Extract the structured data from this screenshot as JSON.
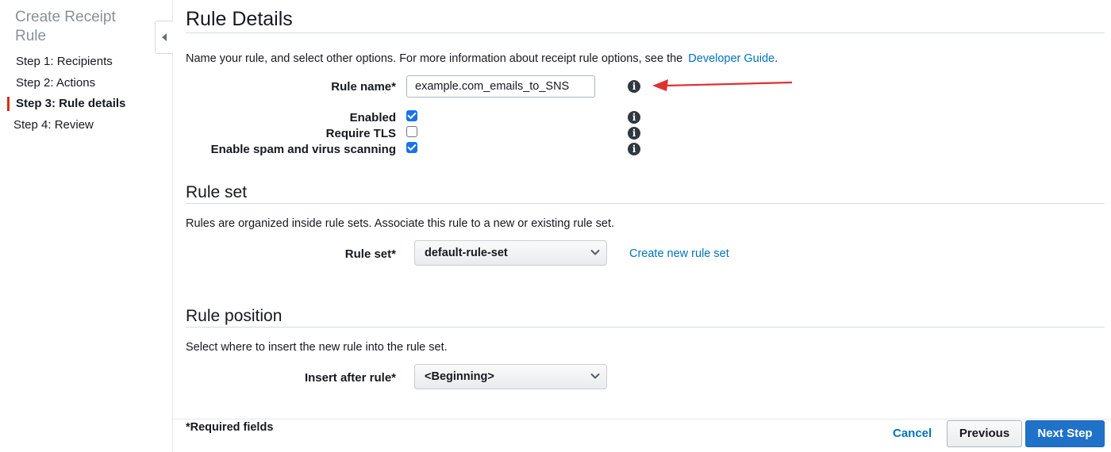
{
  "sidebar": {
    "title": "Create Receipt Rule",
    "steps": [
      {
        "label": "Step 1: Recipients"
      },
      {
        "label": "Step 2: Actions"
      },
      {
        "label": "Step 3: Rule details"
      },
      {
        "label": "Step 4: Review"
      }
    ],
    "active_step": 3
  },
  "rule_details": {
    "heading": "Rule Details",
    "intro": "Name your rule, and select other options. For more information about receipt rule options, see the",
    "intro_link": "Developer Guide",
    "intro_suffix": ".",
    "rule_name_label": "Rule name*",
    "rule_name_value": "example.com_emails_to_SNS",
    "enabled_label": "Enabled",
    "enabled_checked": true,
    "require_tls_label": "Require TLS",
    "require_tls_checked": false,
    "spam_label": "Enable spam and virus scanning",
    "spam_checked": true,
    "info_glyph": "i"
  },
  "rule_set": {
    "heading": "Rule set",
    "intro": "Rules are organized inside rule sets. Associate this rule to a new or existing rule set.",
    "label": "Rule set*",
    "selected": "default-rule-set",
    "create_link": "Create new rule set"
  },
  "rule_position": {
    "heading": "Rule position",
    "intro": "Select where to insert the new rule into the rule set.",
    "label": "Insert after rule*",
    "selected": "<Beginning>"
  },
  "footer": {
    "required_note": "*Required fields",
    "cancel_label": "Cancel",
    "previous_label": "Previous",
    "next_label": "Next Step"
  },
  "colors": {
    "link": "#0073bb",
    "active_step_bar": "#d13212",
    "primary_button": "#1f72c8",
    "annotation_arrow": "#e03030",
    "checkbox_checked": "#1a73e8"
  }
}
